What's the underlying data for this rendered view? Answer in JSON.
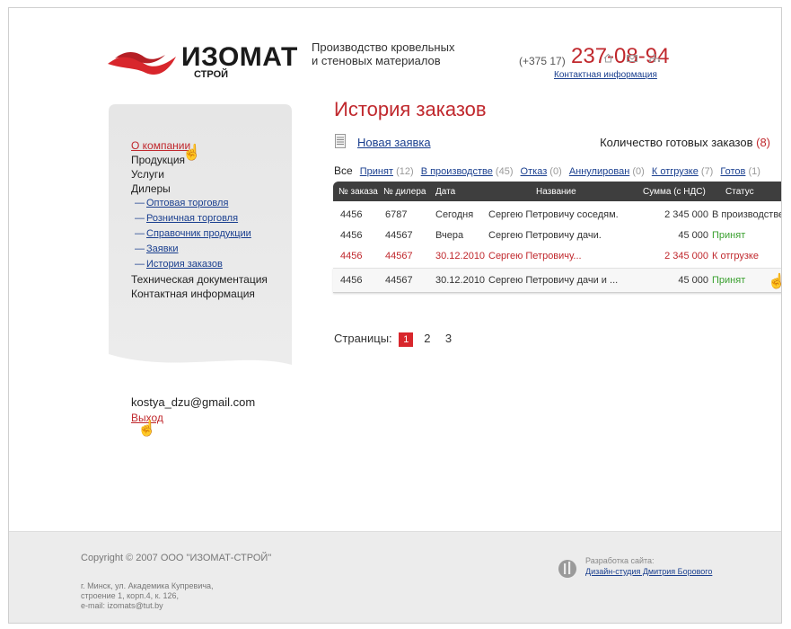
{
  "header": {
    "logo_word": "ИЗОМАТ",
    "logo_sub": "СТРОЙ",
    "tagline_1": "Производство кровельных",
    "tagline_2": "и стеновых материалов",
    "phone_prefix": "(+375 17)",
    "phone_number": "237-08-94",
    "contacts_link": "Контактная информация",
    "icons": [
      "home-icon",
      "mail-icon",
      "sitemap-icon"
    ]
  },
  "sidebar": {
    "items": [
      {
        "label": "О компании"
      },
      {
        "label": "Продукция"
      },
      {
        "label": "Услуги"
      },
      {
        "label": "Дилеры"
      }
    ],
    "sub_items": [
      {
        "label": "Оптовая торговля"
      },
      {
        "label": "Розничная торговля"
      },
      {
        "label": "Справочник продукции"
      },
      {
        "label": "Заявки"
      },
      {
        "label": "История заказов"
      }
    ],
    "items_after": [
      {
        "label": "Техническая документация"
      },
      {
        "label": "Контактная информация"
      }
    ],
    "dash": "—"
  },
  "user": {
    "email": "kostya_dzu@gmail.com",
    "logout": "Выход"
  },
  "main": {
    "title": "История заказов",
    "new_request": "Новая заявка",
    "ready_label": "Количество готовых заказов",
    "ready_count": "(8)",
    "filters": [
      {
        "label": "Все",
        "count": ""
      },
      {
        "label": "Принят",
        "count": "(12)"
      },
      {
        "label": "В производстве",
        "count": "(45)"
      },
      {
        "label": "Отказ",
        "count": "(0)"
      },
      {
        "label": "Аннулирован",
        "count": "(0)"
      },
      {
        "label": "К отгрузке",
        "count": "(7)"
      },
      {
        "label": "Готов",
        "count": "(1)"
      }
    ],
    "table": {
      "headers": [
        "№ заказа",
        "№ дилера",
        "Дата",
        "Название",
        "Сумма (с НДС)",
        "Статус"
      ],
      "rows": [
        {
          "order": "4456",
          "dealer": "6787",
          "date": "Сегодня",
          "name": "Сергею Петровичу соседям.",
          "sum": "2 345 000",
          "status": "В производстве"
        },
        {
          "order": "4456",
          "dealer": "44567",
          "date": "Вчера",
          "name": "Сергею Петровичу дачи.",
          "sum": "45 000",
          "status": "Принят"
        },
        {
          "order": "4456",
          "dealer": "44567",
          "date": "30.12.2010",
          "name": "Сергею Петровичу...",
          "sum": "2 345 000",
          "status": "К отгрузке"
        },
        {
          "order": "4456",
          "dealer": "44567",
          "date": "30.12.2010",
          "name": "Сергею Петровичу дачи и ...",
          "sum": "45 000",
          "status": "Принят"
        }
      ]
    },
    "pager": {
      "label": "Страницы:",
      "pages": [
        "1",
        "2",
        "3"
      ]
    }
  },
  "footer": {
    "copyright": "Copyright © 2007 ООО \"ИЗОМАТ-СТРОЙ\"",
    "address_1": "г. Минск, ул. Академика Купревича,",
    "address_2": "строение 1, корп.4, к. 126,",
    "address_3": "e-mail: izomats@tut.by",
    "dev_label": "Разработка сайта:",
    "dev_link": "Дизайн-студия Дмитрия Борового"
  },
  "colors": {
    "accent": "#c0282d",
    "link": "#1a3f8f",
    "status_green": "#3aa02f",
    "table_header": "#3e3e3e"
  }
}
